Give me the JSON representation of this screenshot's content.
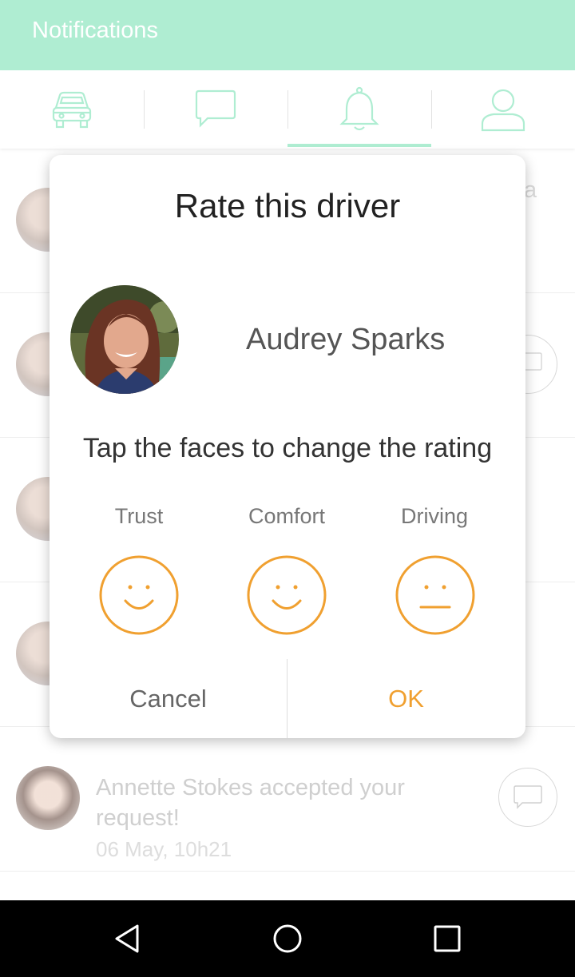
{
  "header": {
    "title": "Notifications"
  },
  "tabs": [
    {
      "icon": "car-icon"
    },
    {
      "icon": "chat-icon"
    },
    {
      "icon": "bell-icon",
      "active": true
    },
    {
      "icon": "user-icon"
    }
  ],
  "background_hint": "a",
  "notifications": [
    {
      "text": "Annette Stokes accepted your request!",
      "time": "06 May, 10h21"
    }
  ],
  "modal": {
    "title": "Rate this driver",
    "driver_name": "Audrey Sparks",
    "instructions": "Tap the faces to change the rating",
    "categories": [
      {
        "label": "Trust",
        "face": "smile"
      },
      {
        "label": "Comfort",
        "face": "smile"
      },
      {
        "label": "Driving",
        "face": "neutral"
      }
    ],
    "cancel_label": "Cancel",
    "ok_label": "OK"
  },
  "colors": {
    "accent": "#afedd2",
    "rating": "#f0a030",
    "ok": "#f0a030"
  }
}
